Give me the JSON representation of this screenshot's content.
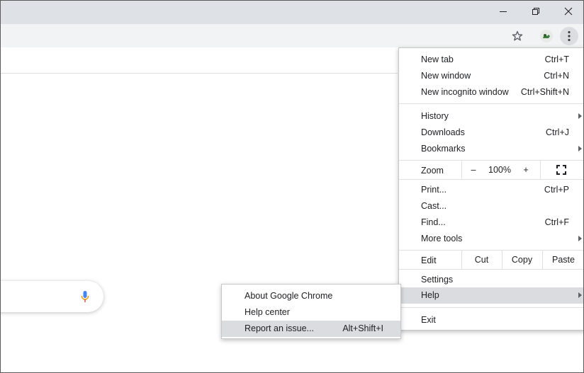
{
  "window": {
    "minimize_icon": "minimize-icon",
    "restore_icon": "restore-icon",
    "close_icon": "close-icon"
  },
  "toolbar": {
    "bookmark_icon": "star-icon",
    "profile_icon": "profile-avatar-icon",
    "menu_icon": "three-dot-menu-icon"
  },
  "main_menu": {
    "new_tab": {
      "label": "New tab",
      "shortcut": "Ctrl+T"
    },
    "new_window": {
      "label": "New window",
      "shortcut": "Ctrl+N"
    },
    "new_incognito": {
      "label": "New incognito window",
      "shortcut": "Ctrl+Shift+N"
    },
    "history": {
      "label": "History"
    },
    "downloads": {
      "label": "Downloads",
      "shortcut": "Ctrl+J"
    },
    "bookmarks": {
      "label": "Bookmarks"
    },
    "zoom": {
      "label": "Zoom",
      "minus": "–",
      "value": "100%",
      "plus": "+"
    },
    "print": {
      "label": "Print...",
      "shortcut": "Ctrl+P"
    },
    "cast": {
      "label": "Cast..."
    },
    "find": {
      "label": "Find...",
      "shortcut": "Ctrl+F"
    },
    "more_tools": {
      "label": "More tools"
    },
    "edit": {
      "label": "Edit",
      "cut": "Cut",
      "copy": "Copy",
      "paste": "Paste"
    },
    "settings": {
      "label": "Settings"
    },
    "help": {
      "label": "Help"
    },
    "exit": {
      "label": "Exit"
    }
  },
  "help_menu": {
    "about": {
      "label": "About Google Chrome"
    },
    "help_center": {
      "label": "Help center"
    },
    "report_issue": {
      "label": "Report an issue...",
      "shortcut": "Alt+Shift+I"
    }
  },
  "colors": {
    "titlebar": "#dee1e6",
    "toolbar": "#f1f3f4",
    "highlight": "#dadce0",
    "mic_blue": "#4285f4"
  }
}
